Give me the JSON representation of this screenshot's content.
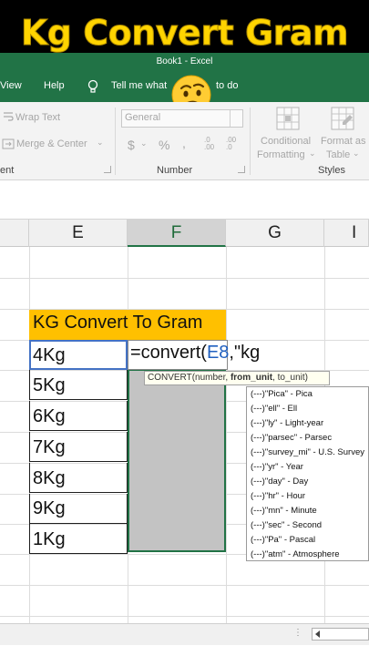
{
  "banner": {
    "title": "Kg  Convert Gram"
  },
  "titlebar": {
    "book_title": "Book1  -  Excel"
  },
  "menu": {
    "view": "View",
    "help": "Help",
    "tell_me": "Tell me what",
    "tell_me_end": "to do"
  },
  "ribbon": {
    "wrap_text": "Wrap Text",
    "merge_center": "Merge & Center",
    "number_format_value": "General",
    "currency_symbol": "$",
    "percent_symbol": "%",
    "comma_symbol": ",",
    "inc_decimal": ".0 .00",
    "dec_decimal": ".00 .0",
    "group_alignment_fragment": "ent",
    "group_number": "Number",
    "conditional": "Conditional",
    "formatting": "Formatting",
    "format_as": "Format as",
    "table": "Table",
    "group_styles": "Styles"
  },
  "columns": [
    "E",
    "F",
    "G",
    "I"
  ],
  "sheet": {
    "header": "KG Convert To Gram",
    "kg_values": [
      "4Kg",
      "5Kg",
      "6Kg",
      "7Kg",
      "8Kg",
      "9Kg",
      "1Kg"
    ],
    "formula_prefix": "=convert(",
    "formula_ref": "E8",
    "formula_suffix": ",\"kg"
  },
  "tooltip": {
    "fn": "CONVERT(number, ",
    "bold_arg": "from_unit",
    "rest": ", to_unit)"
  },
  "autocomplete": [
    "(---)\"Pica\" - Pica",
    "(---)\"ell\" - Ell",
    "(---)\"ly\" - Light-year",
    "(---)\"parsec\" - Parsec",
    "(---)\"survey_mi\" - U.S. Survey",
    "(---)\"yr\" - Year",
    "(---)\"day\" - Day",
    "(---)\"hr\" - Hour",
    "(---)\"mn\" - Minute",
    "(---)\"sec\" - Second",
    "(---)\"Pa\" - Pascal",
    "(---)\"atm\" - Atmosphere"
  ],
  "colors": {
    "excel_green": "#217346",
    "banner_yellow": "#ffd400",
    "header_fill": "#ffc000",
    "selection_blue": "#4472c4"
  },
  "icons": [
    "bulb-icon",
    "thinking-face-icon",
    "conditional-formatting-icon",
    "format-as-table-icon",
    "wrap-text-icon",
    "merge-center-icon"
  ]
}
